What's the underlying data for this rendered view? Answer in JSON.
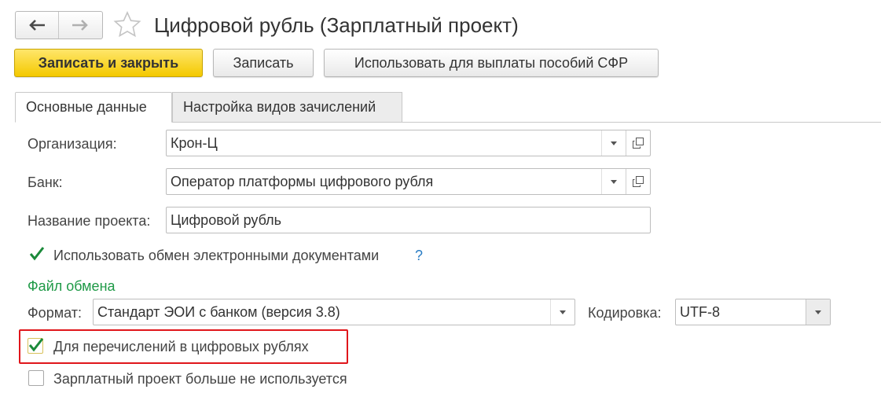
{
  "window": {
    "title": "Цифровой рубль (Зарплатный проект)"
  },
  "toolbar": {
    "save_close_label": "Записать и закрыть",
    "save_label": "Записать",
    "use_for_benefits_label": "Использовать для выплаты пособий СФР"
  },
  "tabs": [
    {
      "label": "Основные данные",
      "active": true
    },
    {
      "label": "Настройка видов зачислений",
      "active": false
    }
  ],
  "form": {
    "organization": {
      "label": "Организация:",
      "value": "Крон-Ц"
    },
    "bank": {
      "label": "Банк:",
      "value": "Оператор платформы цифрового рубля"
    },
    "project_name": {
      "label": "Название проекта:",
      "value": "Цифровой рубль"
    },
    "use_edo": {
      "label": "Использовать обмен электронными документами",
      "checked": true,
      "help": "?"
    },
    "exchange_file_section": "Файл обмена",
    "format": {
      "label": "Формат:",
      "value": "Стандарт ЭОИ с банком (версия 3.8)"
    },
    "encoding": {
      "label": "Кодировка:",
      "value": "UTF-8"
    },
    "digital_ruble_transfers": {
      "label": "Для перечислений в цифровых рублях",
      "checked": true
    },
    "project_not_used": {
      "label": "Зарплатный проект больше не используется",
      "checked": false
    }
  },
  "colors": {
    "primary_button": "#f4c900",
    "section_header": "#1f9a47",
    "check": "#1b8a3a",
    "highlight_box": "#e0161b",
    "help": "#2a7dc5"
  },
  "icons": [
    "back-arrow-icon",
    "forward-arrow-icon",
    "favorite-star-icon",
    "dropdown-icon",
    "open-icon",
    "checkmark-icon",
    "help-icon"
  ]
}
